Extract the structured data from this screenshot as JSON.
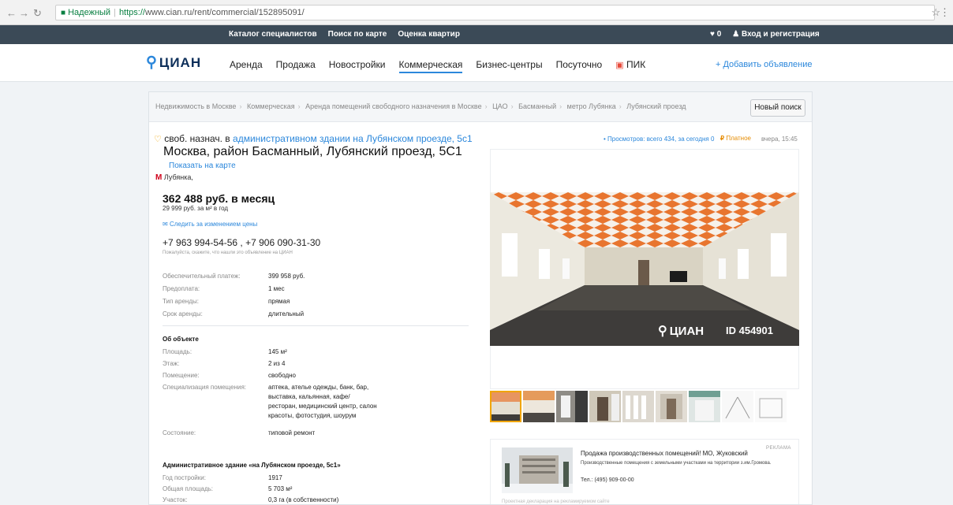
{
  "browser": {
    "secure_label": "Надежный",
    "url_scheme": "https://",
    "url_rest": "www.cian.ru/rent/commercial/152895091/"
  },
  "topbar": {
    "links": [
      "Каталог специалистов",
      "Поиск по карте",
      "Оценка квартир"
    ],
    "favorites_count": "0",
    "login": "Вход и регистрация"
  },
  "header": {
    "logo": "ЦИАН",
    "nav": [
      "Аренда",
      "Продажа",
      "Новостройки",
      "Коммерческая",
      "Бизнес-центры",
      "Посуточно",
      "ПИК"
    ],
    "active_nav": "Коммерческая",
    "add_ad": "+ Добавить объявление"
  },
  "breadcrumb": [
    "Недвижимость в Москве",
    "Коммерческая",
    "Аренда помещений свободного назначения в Москве",
    "ЦАО",
    "Басманный",
    "метро Лубянка",
    "Лубянский проезд"
  ],
  "new_search": "Новый поиск",
  "offer": {
    "type_prefix": "своб. назнач. в",
    "building_link": "административном здании на Лубянском проезде, 5с1",
    "views": "• Просмотров: всего 434, за сегодня 0",
    "paid": "Платное",
    "posted": "вчера, 15:45",
    "address": "Москва, район Басманный, Лубянский проезд, 5С1",
    "show_map": "Показать на карте",
    "metro": "Лубянка,",
    "price": "362 488 руб. в месяц",
    "price_sub": "29 999 руб. за м² в год",
    "follow": "Следить за изменением цены",
    "phones": "+7 963 994-54-56 , +7 906 090-31-30",
    "phone_note": "Пожалуйста, скажите, что нашли это объявление на ЦИАН"
  },
  "terms": [
    {
      "k": "Обеспечительный платеж:",
      "v": "399 958 руб."
    },
    {
      "k": "Предоплата:",
      "v": "1 мес"
    },
    {
      "k": "Тип аренды:",
      "v": "прямая"
    },
    {
      "k": "Срок аренды:",
      "v": "длительный"
    }
  ],
  "about_title": "Об объекте",
  "about": [
    {
      "k": "Площадь:",
      "v": "145 м²"
    },
    {
      "k": "Этаж:",
      "v": "2 из 4"
    },
    {
      "k": "Помещение:",
      "v": "свободно"
    },
    {
      "k": "Специализация помещения:",
      "v": "аптека, ателье одежды, банк, бар, выставка, кальянная, кафе/ресторан, медицинский центр, салон красоты, фотостудия, шоурум"
    },
    {
      "k": "Состояние:",
      "v": "типовой ремонт"
    }
  ],
  "building_title": "Административное здание «на Лубянском проезде, 5с1»",
  "building": [
    {
      "k": "Год постройки:",
      "v": "1917"
    },
    {
      "k": "Общая площадь:",
      "v": "5 703 м²"
    },
    {
      "k": "Участок:",
      "v": "0,3 га (в собственности)"
    }
  ],
  "photo": {
    "watermark": "ЦИАН",
    "id": "ID 454901"
  },
  "ad": {
    "label": "РЕКЛАМА",
    "title": "Продажа производственных помещений! МО, Жуковский",
    "desc": "Производственные помещения с земельными участками на территории з.им.Громова.",
    "tel": "Тел.: (495) 909-00-00",
    "declaration": "Проектная декларация на рекламируемом сайте"
  }
}
